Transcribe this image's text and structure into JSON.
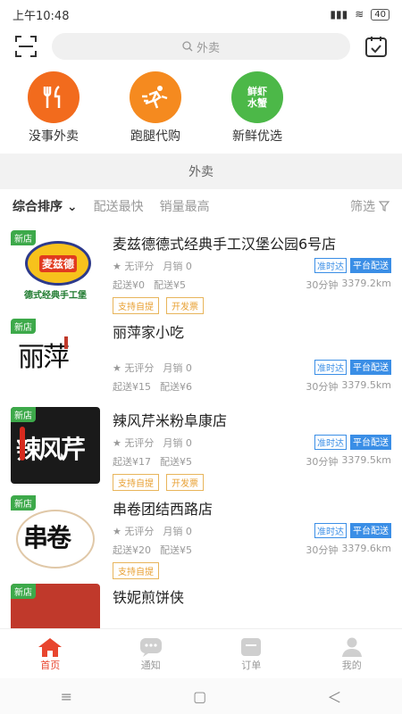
{
  "status": {
    "time": "上午10:48",
    "signal": "▮▮▮",
    "wifi": "≋",
    "battery": "40"
  },
  "search": {
    "placeholder": "外卖",
    "icon": "search-icon"
  },
  "quick_nav": [
    {
      "label": "没事外卖",
      "icon": "utensils-icon",
      "color": "#f26b1d"
    },
    {
      "label": "跑腿代购",
      "icon": "runner-icon",
      "color": "#f58a1f"
    },
    {
      "label": "新鲜优选",
      "icon": "fresh-icon",
      "color": "#4cb848",
      "text": "鲜虾\n水蟹"
    }
  ],
  "section_title": "外卖",
  "filters": {
    "sort": "综合排序",
    "fast": "配送最快",
    "sales": "销量最高",
    "filter": "筛选"
  },
  "stores": [
    {
      "name": "麦兹德德式经典手工汉堡公园6号店",
      "rating": "无评分",
      "monthly": "月销 0",
      "min": "起送¥0",
      "fee": "配送¥5",
      "time": "30分钟",
      "distance": "3379.2km",
      "tag_on": "准时达",
      "tag_self": "平台配送",
      "promos": [
        "支持自提",
        "开发票"
      ],
      "new": "新店",
      "logo_text": "麦兹德",
      "logo_sub": "德式经典手工堡",
      "logo_color": "#e13a1f"
    },
    {
      "name": "丽萍家小吃",
      "rating": "无评分",
      "monthly": "月销 0",
      "min": "起送¥15",
      "fee": "配送¥6",
      "time": "30分钟",
      "distance": "3379.5km",
      "tag_on": "准时达",
      "tag_self": "平台配送",
      "promos": [],
      "new": "新店",
      "logo_text": "丽萍",
      "logo_sub": "",
      "logo_color": "#111111"
    },
    {
      "name": "辣风芹米粉阜康店",
      "rating": "无评分",
      "monthly": "月销 0",
      "min": "起送¥17",
      "fee": "配送¥5",
      "time": "30分钟",
      "distance": "3379.5km",
      "tag_on": "准时达",
      "tag_self": "平台配送",
      "promos": [
        "支持自提",
        "开发票"
      ],
      "new": "新店",
      "logo_text": "辣风芹",
      "logo_sub": "",
      "logo_color": "#ffffff"
    },
    {
      "name": "串卷团结西路店",
      "rating": "无评分",
      "monthly": "月销 0",
      "min": "起送¥20",
      "fee": "配送¥5",
      "time": "30分钟",
      "distance": "3379.6km",
      "tag_on": "准时达",
      "tag_self": "平台配送",
      "promos": [
        "支持自提"
      ],
      "new": "新店",
      "logo_text": "串卷",
      "logo_sub": "",
      "logo_color": "#111111"
    },
    {
      "name": "铁妮煎饼侠",
      "rating": "",
      "monthly": "",
      "min": "",
      "fee": "",
      "time": "",
      "distance": "",
      "tag_on": "",
      "tag_self": "",
      "promos": [],
      "new": "新店",
      "logo_text": "",
      "logo_sub": "",
      "logo_color": "#c0392b"
    }
  ],
  "bottom_nav": [
    {
      "label": "首页",
      "icon": "home-icon",
      "active": true
    },
    {
      "label": "通知",
      "icon": "message-icon",
      "active": false
    },
    {
      "label": "订单",
      "icon": "order-icon",
      "active": false
    },
    {
      "label": "我的",
      "icon": "user-icon",
      "active": false
    }
  ],
  "sys_nav": {
    "menu": "≡",
    "home": "▢",
    "back": "＜"
  }
}
